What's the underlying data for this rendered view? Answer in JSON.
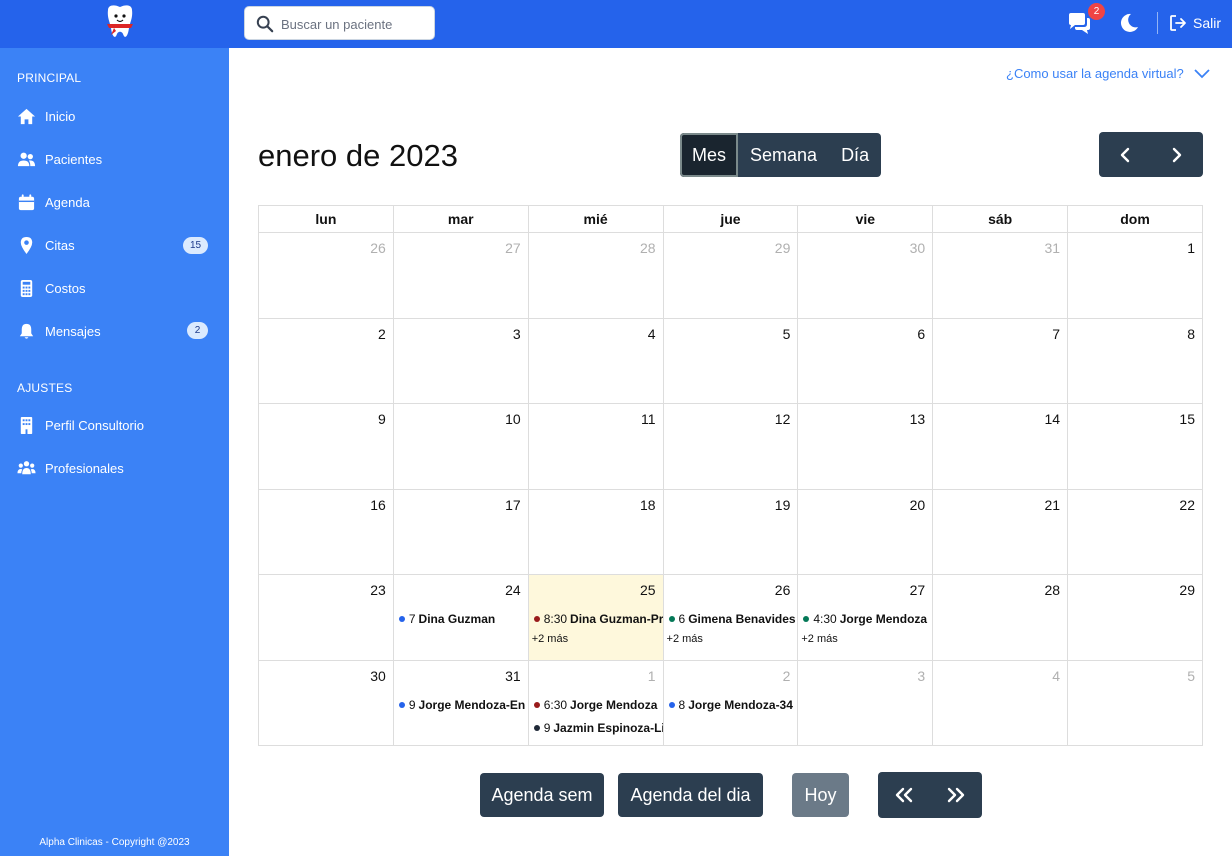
{
  "search": {
    "placeholder": "Buscar un paciente"
  },
  "topbar": {
    "chat_count": "2",
    "logout_label": "Salir"
  },
  "sidebar": {
    "section_principal": "PRINCIPAL",
    "items": [
      {
        "label": "Inicio",
        "icon": "home-icon"
      },
      {
        "label": "Pacientes",
        "icon": "users-icon"
      },
      {
        "label": "Agenda",
        "icon": "calendar-icon"
      },
      {
        "label": "Citas",
        "icon": "map-pin-icon",
        "badge": "15"
      },
      {
        "label": "Costos",
        "icon": "calculator-icon"
      },
      {
        "label": "Mensajes",
        "icon": "bell-icon",
        "badge": "2"
      }
    ],
    "section_ajustes": "AJUSTES",
    "settings": [
      {
        "label": "Perfil Consultorio",
        "icon": "building-icon"
      },
      {
        "label": "Profesionales",
        "icon": "people-group-icon"
      }
    ],
    "copyright": "Alpha Clinicas - Copyright @2023"
  },
  "help_link": "¿Como usar la agenda virtual?",
  "calendar": {
    "title": "enero de 2023",
    "views": [
      "Mes",
      "Semana",
      "Día"
    ],
    "active_view": "Mes",
    "weekdays": [
      "lun",
      "mar",
      "mié",
      "jue",
      "vie",
      "sáb",
      "dom"
    ],
    "weeks": [
      [
        {
          "d": "26",
          "o": true
        },
        {
          "d": "27",
          "o": true
        },
        {
          "d": "28",
          "o": true
        },
        {
          "d": "29",
          "o": true
        },
        {
          "d": "30",
          "o": true
        },
        {
          "d": "31",
          "o": true
        },
        {
          "d": "1"
        }
      ],
      [
        {
          "d": "2"
        },
        {
          "d": "3"
        },
        {
          "d": "4"
        },
        {
          "d": "5"
        },
        {
          "d": "6"
        },
        {
          "d": "7"
        },
        {
          "d": "8"
        }
      ],
      [
        {
          "d": "9"
        },
        {
          "d": "10"
        },
        {
          "d": "11"
        },
        {
          "d": "12"
        },
        {
          "d": "13"
        },
        {
          "d": "14"
        },
        {
          "d": "15"
        }
      ],
      [
        {
          "d": "16"
        },
        {
          "d": "17"
        },
        {
          "d": "18"
        },
        {
          "d": "19"
        },
        {
          "d": "20"
        },
        {
          "d": "21"
        },
        {
          "d": "22"
        }
      ],
      [
        {
          "d": "23"
        },
        {
          "d": "24",
          "events": [
            {
              "time": "7",
              "name": "Dina Guzman",
              "color": "#2563eb"
            }
          ]
        },
        {
          "d": "25",
          "today": true,
          "events": [
            {
              "time": "8:30",
              "name": "Dina Guzman-Pr",
              "color": "#991b1b"
            }
          ],
          "more": "+2 más"
        },
        {
          "d": "26",
          "events": [
            {
              "time": "6",
              "name": "Gimena Benavides",
              "color": "#047857"
            }
          ],
          "more": "+2 más"
        },
        {
          "d": "27",
          "events": [
            {
              "time": "4:30",
              "name": "Jorge Mendoza",
              "color": "#047857"
            }
          ],
          "more": "+2 más"
        },
        {
          "d": "28"
        },
        {
          "d": "29"
        }
      ],
      [
        {
          "d": "30"
        },
        {
          "d": "31",
          "events": [
            {
              "time": "9",
              "name": "Jorge Mendoza-En",
              "color": "#2563eb"
            }
          ]
        },
        {
          "d": "1",
          "o": true,
          "events": [
            {
              "time": "6:30",
              "name": "Jorge Mendoza",
              "color": "#991b1b"
            },
            {
              "time": "9",
              "name": "Jazmin Espinoza-Li",
              "color": "#1f2937"
            }
          ]
        },
        {
          "d": "2",
          "o": true,
          "events": [
            {
              "time": "8",
              "name": "Jorge Mendoza-34",
              "color": "#2563eb"
            }
          ]
        },
        {
          "d": "3",
          "o": true
        },
        {
          "d": "4",
          "o": true
        },
        {
          "d": "5",
          "o": true
        }
      ]
    ]
  },
  "bottom": {
    "week_agenda": "Agenda sem",
    "day_agenda": "Agenda del dia",
    "today": "Hoy"
  },
  "colors": {
    "topbar": "#2563eb",
    "sidebar": "#3b82f6",
    "button": "#2c3e50",
    "today_cell": "#fef8dc"
  }
}
